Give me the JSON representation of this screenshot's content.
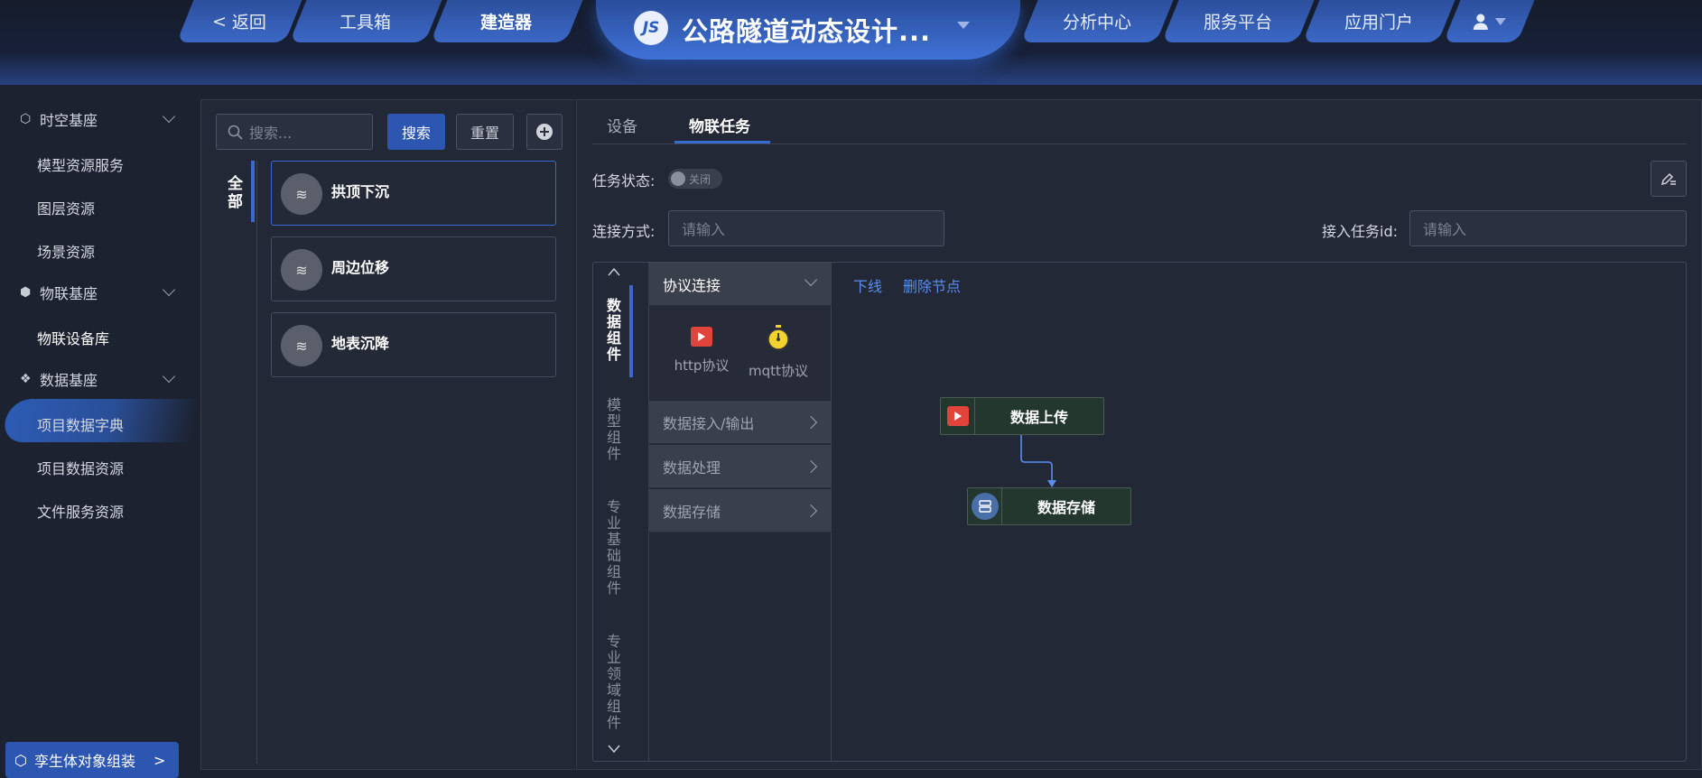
{
  "nav": {
    "back": "返回",
    "toolbox": "工具箱",
    "builder": "建造器",
    "title": "公路隧道动态设计...",
    "analysis": "分析中心",
    "services": "服务平台",
    "portal": "应用门户",
    "logo_text": "JS"
  },
  "sidebar": {
    "groups": [
      {
        "label": "时空基座",
        "items": [
          "模型资源服务",
          "图层资源",
          "场景资源"
        ]
      },
      {
        "label": "物联基座",
        "items": [
          "物联设备库"
        ]
      },
      {
        "label": "数据基座",
        "items": [
          "项目数据字典",
          "项目数据资源",
          "文件服务资源"
        ]
      }
    ],
    "active_item": "物联设备库",
    "bottom_button": "孪生体对象组装"
  },
  "left_panel": {
    "search_placeholder": "搜索...",
    "search_button": "搜索",
    "reset_button": "重置",
    "category": "全部",
    "cards": [
      "拱顶下沉",
      "周边位移",
      "地表沉降"
    ],
    "card_avatar": "≋"
  },
  "right_panel": {
    "tabs": [
      "设备",
      "物联任务"
    ],
    "active_tab": "物联任务",
    "task_status_label": "任务状态:",
    "task_status_value": "关闭",
    "connection_label": "连接方式:",
    "connection_placeholder": "请输入",
    "task_id_label": "接入任务id:",
    "task_id_placeholder": "请输入",
    "vertical_tabs": [
      "数据组件",
      "模型组件",
      "专业基础组件",
      "专业领域组件"
    ],
    "accordion": {
      "open_section": "协议连接",
      "protocols": [
        "http协议",
        "mqtt协议"
      ],
      "sections": [
        "数据接入/输出",
        "数据处理",
        "数据存储"
      ]
    },
    "canvas_actions": [
      "下线",
      "删除节点"
    ],
    "nodes": [
      "数据上传",
      "数据存储"
    ]
  },
  "colors": {
    "accent": "#2d56b0",
    "link": "#5a8ef0",
    "node_bg": "#24372f",
    "http_icon": "#e0443a",
    "mqtt_icon": "#f2d22e"
  }
}
